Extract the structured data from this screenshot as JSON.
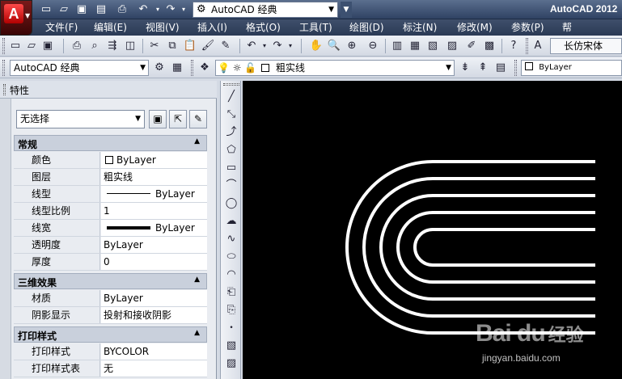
{
  "title_bar": {
    "workspace": "AutoCAD 经典",
    "app_title": "AutoCAD 2012"
  },
  "menu": {
    "items": [
      "文件(F)",
      "编辑(E)",
      "视图(V)",
      "插入(I)",
      "格式(O)",
      "工具(T)",
      "绘图(D)",
      "标注(N)",
      "修改(M)",
      "参数(P)",
      "帮"
    ]
  },
  "toolbar2": {
    "text_style": "长仿宋体"
  },
  "toolbar3": {
    "workspace": "AutoCAD 经典",
    "layer": "粗实线",
    "color": "ByLayer"
  },
  "properties": {
    "title": "特性",
    "selection": "无选择",
    "sections": [
      {
        "title": "常规",
        "rows": [
          {
            "name": "颜色",
            "value": "ByLayer",
            "sample": "swatch"
          },
          {
            "name": "图层",
            "value": "粗实线",
            "sample": ""
          },
          {
            "name": "线型",
            "value": "ByLayer",
            "sample": "linetype"
          },
          {
            "name": "线型比例",
            "value": "1",
            "sample": ""
          },
          {
            "name": "线宽",
            "value": "ByLayer",
            "sample": "lineweight"
          },
          {
            "name": "透明度",
            "value": "ByLayer",
            "sample": ""
          },
          {
            "name": "厚度",
            "value": "0",
            "sample": ""
          }
        ]
      },
      {
        "title": "三维效果",
        "rows": [
          {
            "name": "材质",
            "value": "ByLayer",
            "sample": ""
          },
          {
            "name": "阴影显示",
            "value": "投射和接收阴影",
            "sample": ""
          }
        ]
      },
      {
        "title": "打印样式",
        "rows": [
          {
            "name": "打印样式",
            "value": "BYCOLOR",
            "sample": ""
          },
          {
            "name": "打印样式表",
            "value": "无",
            "sample": ""
          }
        ]
      }
    ]
  },
  "drawing": {
    "description_color": "#ffffff"
  },
  "watermark": {
    "logo": "Bai du",
    "logo_suffix": "经验",
    "url": "jingyan.baidu.com"
  }
}
